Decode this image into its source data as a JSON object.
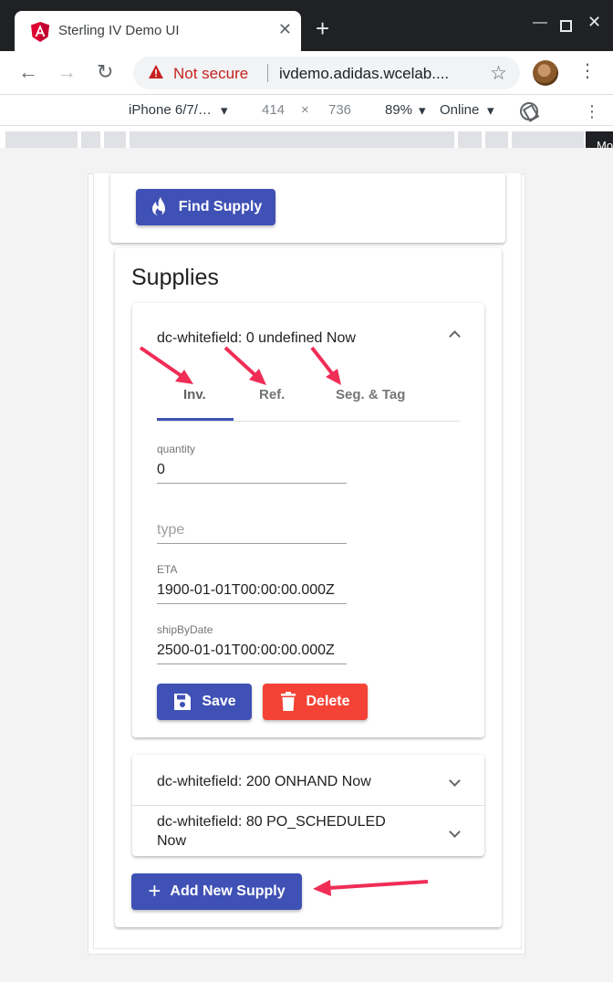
{
  "browser": {
    "tab_title": "Sterling IV Demo UI",
    "tab_close": "✕",
    "new_tab": "+",
    "security_label": "Not secure",
    "url": "ivdemo.adidas.wcelab....",
    "device_name": "iPhone 6/7/…",
    "device_width": "414",
    "times": "×",
    "device_height": "736",
    "zoom": "89%",
    "network": "Online",
    "tooltip_fragment": "Mo"
  },
  "app": {
    "find_supply_label": "Find Supply",
    "supplies_title": "Supplies",
    "expanded_panel": {
      "header": "dc-whitefield: 0 undefined Now",
      "tabs": [
        {
          "label": "Inv."
        },
        {
          "label": "Ref."
        },
        {
          "label": "Seg. & Tag"
        }
      ],
      "fields": {
        "quantity": {
          "label": "quantity",
          "value": "0"
        },
        "type": {
          "placeholder": "type"
        },
        "eta": {
          "label": "ETA",
          "value": "1900-01-01T00:00:00.000Z"
        },
        "ship_by_date": {
          "label": "shipByDate",
          "value": "2500-01-01T00:00:00.000Z"
        }
      },
      "save_label": "Save",
      "delete_label": "Delete"
    },
    "collapsed_panels": [
      {
        "header": "dc-whitefield: 200 ONHAND Now"
      },
      {
        "header": "dc-whitefield: 80 PO_SCHEDULED Now"
      }
    ],
    "add_supply_label": "Add New Supply"
  },
  "colors": {
    "primary": "#3f51b5",
    "danger": "#f44336",
    "annotation_arrow": "#ef2d56"
  }
}
